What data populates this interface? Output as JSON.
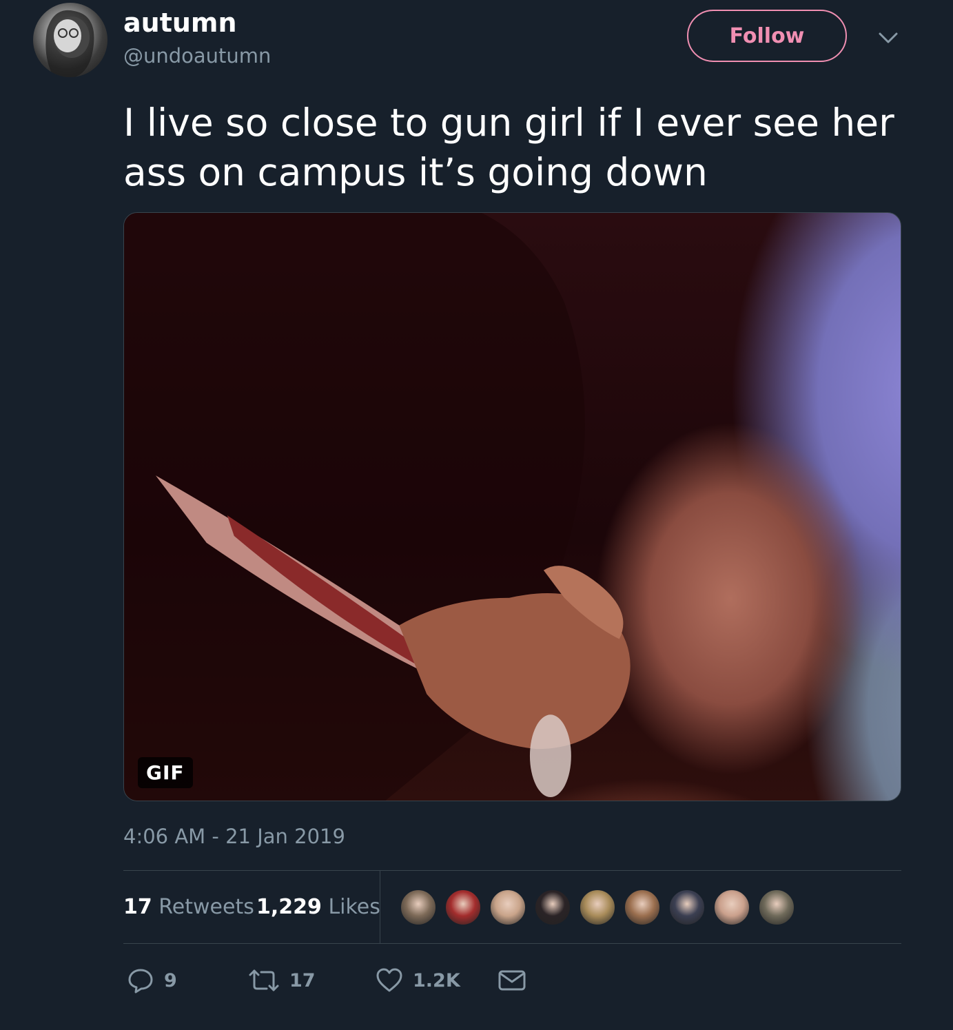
{
  "user": {
    "display_name": "autumn",
    "handle": "@undoautumn",
    "avatar_icon": "profile-photo"
  },
  "header": {
    "follow_label": "Follow",
    "menu_icon": "chevron-down-icon",
    "accent_color": "#f08fb2"
  },
  "tweet": {
    "text": "I live so close to gun girl if I ever see her ass on campus it’s going down",
    "media_badge": "GIF",
    "timestamp": "4:06 AM - 21 Jan 2019"
  },
  "stats": {
    "retweets_count": "17",
    "retweets_label": "Retweets",
    "likes_count": "1,229",
    "likes_label": "Likes"
  },
  "likers": [
    {
      "name": "liker-avatar-1",
      "color": "#7d6a58"
    },
    {
      "name": "liker-avatar-2",
      "color": "#a32d2d"
    },
    {
      "name": "liker-avatar-3",
      "color": "#c9a48a"
    },
    {
      "name": "liker-avatar-4",
      "color": "#2a2326"
    },
    {
      "name": "liker-avatar-5",
      "color": "#a98c5a"
    },
    {
      "name": "liker-avatar-6",
      "color": "#9b6f4f"
    },
    {
      "name": "liker-avatar-7",
      "color": "#3b3f52"
    },
    {
      "name": "liker-avatar-8",
      "color": "#caa08c"
    },
    {
      "name": "liker-avatar-9",
      "color": "#6f6a5a"
    }
  ],
  "actions": {
    "reply_count": "9",
    "retweet_count": "17",
    "like_count": "1.2K",
    "icon_color": "#8899a6"
  },
  "colors": {
    "background": "#17202b",
    "secondary_text": "#8899a6",
    "divider": "#38444d"
  }
}
